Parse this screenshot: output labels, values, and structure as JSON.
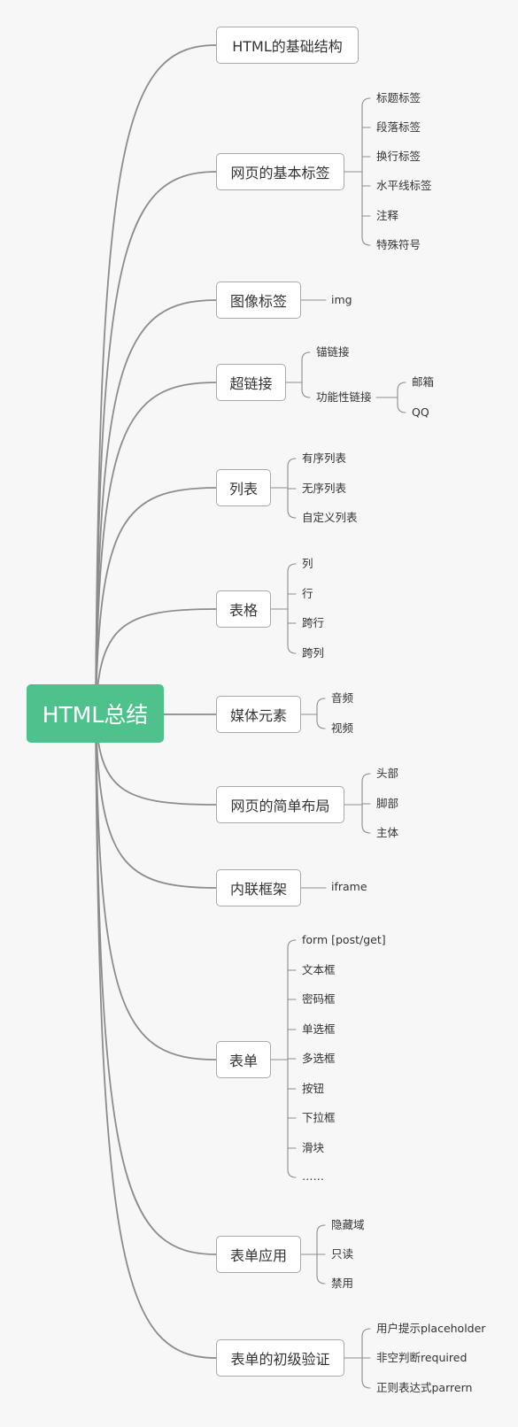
{
  "root": {
    "label": "HTML总结"
  },
  "branches": [
    {
      "id": "b0",
      "label": "HTML的基础结构",
      "children": []
    },
    {
      "id": "b1",
      "label": "网页的基本标签",
      "children": [
        {
          "label": "标题标签"
        },
        {
          "label": "段落标签"
        },
        {
          "label": "换行标签"
        },
        {
          "label": "水平线标签"
        },
        {
          "label": "注释"
        },
        {
          "label": "特殊符号"
        }
      ]
    },
    {
      "id": "b2",
      "label": "图像标签",
      "children": [
        {
          "label": "img"
        }
      ]
    },
    {
      "id": "b3",
      "label": "超链接",
      "children": [
        {
          "label": "锚链接"
        },
        {
          "label": "功能性链接",
          "children": [
            {
              "label": "邮箱"
            },
            {
              "label": "QQ"
            }
          ]
        }
      ]
    },
    {
      "id": "b4",
      "label": "列表",
      "children": [
        {
          "label": "有序列表"
        },
        {
          "label": "无序列表"
        },
        {
          "label": "自定义列表"
        }
      ]
    },
    {
      "id": "b5",
      "label": "表格",
      "children": [
        {
          "label": "列"
        },
        {
          "label": "行"
        },
        {
          "label": "跨行"
        },
        {
          "label": "跨列"
        }
      ]
    },
    {
      "id": "b6",
      "label": "媒体元素",
      "children": [
        {
          "label": "音频"
        },
        {
          "label": "视频"
        }
      ]
    },
    {
      "id": "b7",
      "label": "网页的简单布局",
      "children": [
        {
          "label": "头部"
        },
        {
          "label": "脚部"
        },
        {
          "label": "主体"
        }
      ]
    },
    {
      "id": "b8",
      "label": "内联框架",
      "children": [
        {
          "label": "iframe"
        }
      ]
    },
    {
      "id": "b9",
      "label": "表单",
      "children": [
        {
          "label": "form [post/get]"
        },
        {
          "label": "文本框"
        },
        {
          "label": "密码框"
        },
        {
          "label": "单选框"
        },
        {
          "label": "多选框"
        },
        {
          "label": "按钮"
        },
        {
          "label": "下拉框"
        },
        {
          "label": "滑块"
        },
        {
          "label": "……"
        }
      ]
    },
    {
      "id": "b10",
      "label": "表单应用",
      "children": [
        {
          "label": "隐藏域"
        },
        {
          "label": "只读"
        },
        {
          "label": "禁用"
        }
      ]
    },
    {
      "id": "b11",
      "label": "表单的初级验证",
      "children": [
        {
          "label": "用户提示placeholder"
        },
        {
          "label": "非空判断required"
        },
        {
          "label": "正则表达式parrern"
        }
      ]
    }
  ],
  "colors": {
    "root_bg": "#4fc18c",
    "line": "#8c8c8c",
    "node_border": "#a9a9a9",
    "text": "#333333"
  }
}
